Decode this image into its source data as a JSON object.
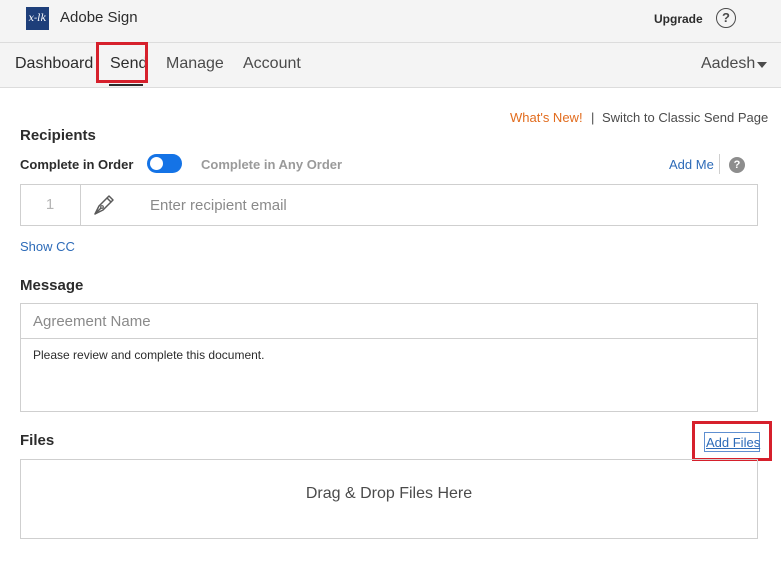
{
  "app": {
    "title": "Adobe Sign",
    "logo_text": "x-lk"
  },
  "header": {
    "upgrade_label": "Upgrade",
    "help_symbol": "?"
  },
  "nav": {
    "items": [
      {
        "label": "Dashboard"
      },
      {
        "label": "Send",
        "active": true
      },
      {
        "label": "Manage"
      },
      {
        "label": "Account"
      }
    ],
    "user_name": "Aadesh"
  },
  "links": {
    "whats_new": "What's New!",
    "separator": "|",
    "classic_send": "Switch to Classic Send Page"
  },
  "recipients": {
    "title": "Recipients",
    "complete_in_order": "Complete in Order",
    "complete_any_order": "Complete in Any Order",
    "order_toggle_on": true,
    "add_me": "Add Me",
    "help_symbol": "?",
    "row_number": "1",
    "email_placeholder": "Enter recipient email",
    "show_cc": "Show CC"
  },
  "message": {
    "title": "Message",
    "agreement_placeholder": "Agreement Name",
    "body": "Please review and complete this document."
  },
  "files": {
    "title": "Files",
    "add_files": "Add Files",
    "dropzone_text": "Drag & Drop Files Here"
  },
  "colors": {
    "accent": "#1473e6",
    "link": "#2d6bb8",
    "highlight": "#d6202c",
    "whats_new": "#e26c1e"
  }
}
